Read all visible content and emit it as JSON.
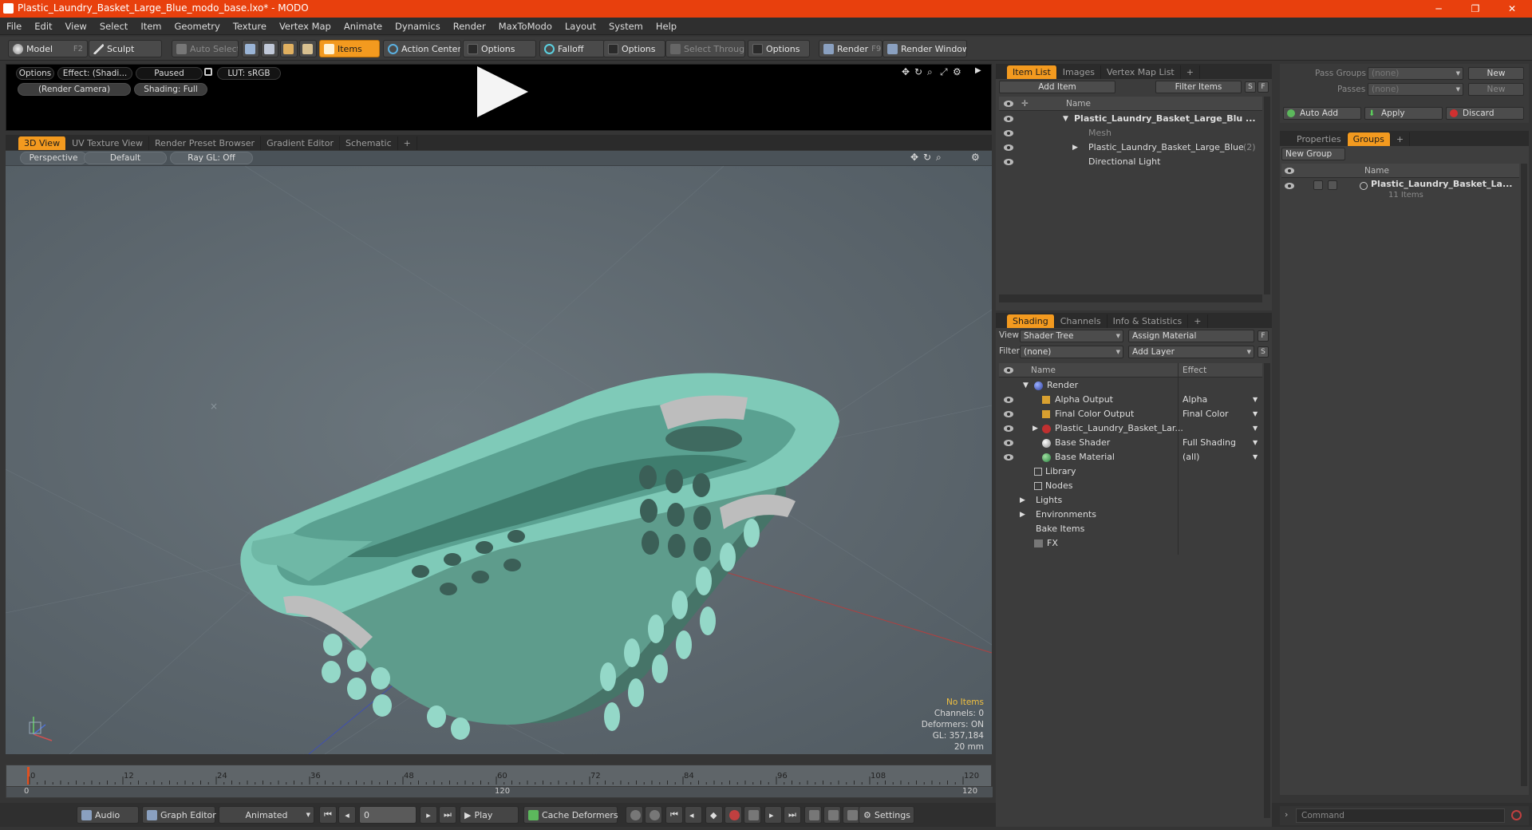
{
  "window": {
    "title": "Plastic_Laundry_Basket_Large_Blue_modo_base.lxo* - MODO",
    "minimize": "─",
    "restore": "❐",
    "close": "✕"
  },
  "menu": [
    "File",
    "Edit",
    "View",
    "Select",
    "Item",
    "Geometry",
    "Texture",
    "Vertex Map",
    "Animate",
    "Dynamics",
    "Render",
    "MaxToModo",
    "Layout",
    "System",
    "Help"
  ],
  "toolbar": {
    "model": "Model",
    "model_key": "F2",
    "sculpt": "Sculpt",
    "auto_select": "Auto Select",
    "items": "Items",
    "action_center": "Action Center",
    "options1": "Options",
    "falloff": "Falloff",
    "options2": "Options",
    "select_through": "Select Through",
    "options3": "Options",
    "render": "Render",
    "render_key": "F9",
    "render_window": "Render Window"
  },
  "preview": {
    "options": "Options",
    "effect": "Effect: (Shadi...",
    "paused": "Paused",
    "lut": "LUT: sRGB",
    "camera": "(Render Camera)",
    "shading": "Shading: Full"
  },
  "viewport_tabs": [
    "3D View",
    "UV Texture View",
    "Render Preset Browser",
    "Gradient Editor",
    "Schematic",
    "+"
  ],
  "viewport": {
    "perspective": "Perspective",
    "default": "Default",
    "raygl": "Ray GL: Off"
  },
  "stats": {
    "items": "No Items",
    "channels": "Channels: 0",
    "deformers": "Deformers: ON",
    "gl": "GL: 357,184",
    "unit": "20 mm"
  },
  "timeline": {
    "ticks": [
      "0",
      "12",
      "24",
      "36",
      "48",
      "60",
      "72",
      "84",
      "96",
      "108",
      "120"
    ],
    "start": "0",
    "mid": "120",
    "end": "120"
  },
  "bottombar": {
    "audio": "Audio",
    "graph_editor": "Graph Editor",
    "animated": "Animated",
    "frame": "0",
    "play": "Play",
    "cache": "Cache Deformers",
    "settings": "Settings"
  },
  "item_list": {
    "tabs": [
      "Item List",
      "Images",
      "Vertex Map List",
      "+"
    ],
    "add_item": "Add Item",
    "filter": "Filter Items",
    "s": "S",
    "f": "F",
    "col_name": "Name",
    "rows": [
      {
        "label": "Plastic_Laundry_Basket_Large_Blu ...",
        "bold": true
      },
      {
        "label": "Mesh",
        "dim": true
      },
      {
        "label": "Plastic_Laundry_Basket_Large_Blue",
        "count": "(2)"
      },
      {
        "label": "Directional Light"
      }
    ]
  },
  "shading": {
    "tabs": [
      "Shading",
      "Channels",
      "Info & Statistics",
      "+"
    ],
    "view_label": "View",
    "view_value": "Shader Tree",
    "assign": "Assign Material",
    "f": "F",
    "filter_label": "Filter",
    "filter_value": "(none)",
    "add_layer": "Add Layer",
    "s": "S",
    "col_name": "Name",
    "col_effect": "Effect",
    "rows": [
      {
        "label": "Render",
        "effect": ""
      },
      {
        "label": "Alpha Output",
        "effect": "Alpha"
      },
      {
        "label": "Final Color Output",
        "effect": "Final Color"
      },
      {
        "label": "Plastic_Laundry_Basket_Lar...",
        "effect": ""
      },
      {
        "label": "Base Shader",
        "effect": "Full Shading"
      },
      {
        "label": "Base Material",
        "effect": "(all)"
      },
      {
        "label": "Library",
        "effect": ""
      },
      {
        "label": "Nodes",
        "effect": ""
      },
      {
        "label": "Lights",
        "effect": ""
      },
      {
        "label": "Environments",
        "effect": ""
      },
      {
        "label": "Bake Items",
        "effect": ""
      },
      {
        "label": "FX",
        "effect": ""
      }
    ]
  },
  "groups": {
    "pass_groups": "Pass Groups",
    "pass_value": "(none)",
    "new1": "New",
    "passes": "Passes",
    "passes_value": "(none)",
    "new2": "New",
    "auto_add": "Auto Add",
    "apply": "Apply",
    "discard": "Discard",
    "tabs": [
      "Properties",
      "Groups",
      "+"
    ],
    "new_group": "New Group",
    "col_name": "Name",
    "group_name": "Plastic_Laundry_Basket_La...",
    "group_count": "11 Items",
    "command": "Command"
  },
  "colors": {
    "accent": "#f39a1f",
    "title": "#e8400d",
    "basket": "#7fcab8"
  }
}
